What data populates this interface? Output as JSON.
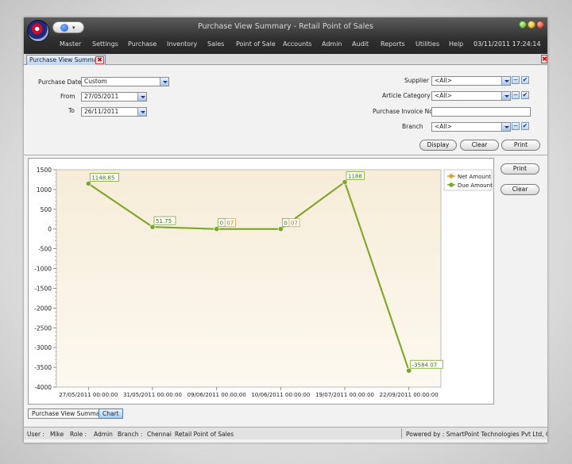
{
  "window": {
    "title": "Purchase View Summary - Retail Point of Sales",
    "clock": "03/11/2011 17:24:14"
  },
  "menu": [
    "Master",
    "Settings",
    "Purchase",
    "Inventory",
    "Sales",
    "Point of Sale",
    "Accounts",
    "Admin",
    "Audit",
    "Reports",
    "Utilities",
    "Help"
  ],
  "doc_tab": {
    "label": "Purchase View Summary",
    "close": "✖"
  },
  "form": {
    "purchase_date": {
      "label": "Purchase Date",
      "value": "Custom"
    },
    "from": {
      "label": "From",
      "value": "27/05/2011"
    },
    "to": {
      "label": "To",
      "value": "26/11/2011"
    },
    "supplier": {
      "label": "Supplier",
      "required": "*",
      "value": "<All>"
    },
    "article_category": {
      "label": "Article Category",
      "required": "*",
      "value": "<All>"
    },
    "purchase_invoice_no": {
      "label": "Purchase  Invoice  No",
      "value": ""
    },
    "branch": {
      "label": "Branch",
      "value": "<All>"
    },
    "buttons": {
      "display": "Display",
      "clear": "Clear",
      "print": "Print"
    }
  },
  "chart_panel": {
    "print": "Print",
    "clear": "Clear"
  },
  "chart_data": {
    "type": "line",
    "categories": [
      "27/05/2011 00:00:00",
      "31/05/2011 00:00:00",
      "09/06/2011 00:00:00",
      "10/06/2011 00:00:00",
      "19/07/2011 00:00:00",
      "22/09/2011 00:00:00"
    ],
    "series": [
      {
        "name": "Net Amount",
        "color": "#e0a030",
        "values": [
          1148.85,
          51.75,
          0.07,
          0.07,
          1188,
          -3584.07
        ]
      },
      {
        "name": "Due Amount",
        "color": "#7aa82a",
        "values": [
          1148.85,
          51.75,
          0,
          0,
          1188,
          -3584.07
        ]
      }
    ],
    "point_labels": [
      {
        "index": 0,
        "due": "1148.85"
      },
      {
        "index": 1,
        "due": "51.75"
      },
      {
        "index": 2,
        "due": "0",
        "net": "07"
      },
      {
        "index": 3,
        "due": "0",
        "net": "07"
      },
      {
        "index": 4,
        "due": "1188"
      },
      {
        "index": 5,
        "due": "-3584.07"
      }
    ],
    "yticks": [
      1500,
      1000,
      500,
      0,
      -500,
      -1000,
      -1500,
      -2000,
      -2500,
      -3000,
      -3500,
      -4000
    ],
    "ylim": [
      -4000,
      1500
    ],
    "legend_position": "top-right",
    "title": "",
    "xlabel": "",
    "ylabel": ""
  },
  "bottom_tabs": [
    "Purchase View Summary",
    "Chart"
  ],
  "status": {
    "user_label": "User :",
    "user": "Mike",
    "role_label": "Role :",
    "role": "Admin",
    "branch_label": "Branch :",
    "branch": "Chennai",
    "app": "Retail Point of Sales",
    "powered_by": "Powered by : SmartPoint Technologies Pvt Ltd, Chennai"
  }
}
